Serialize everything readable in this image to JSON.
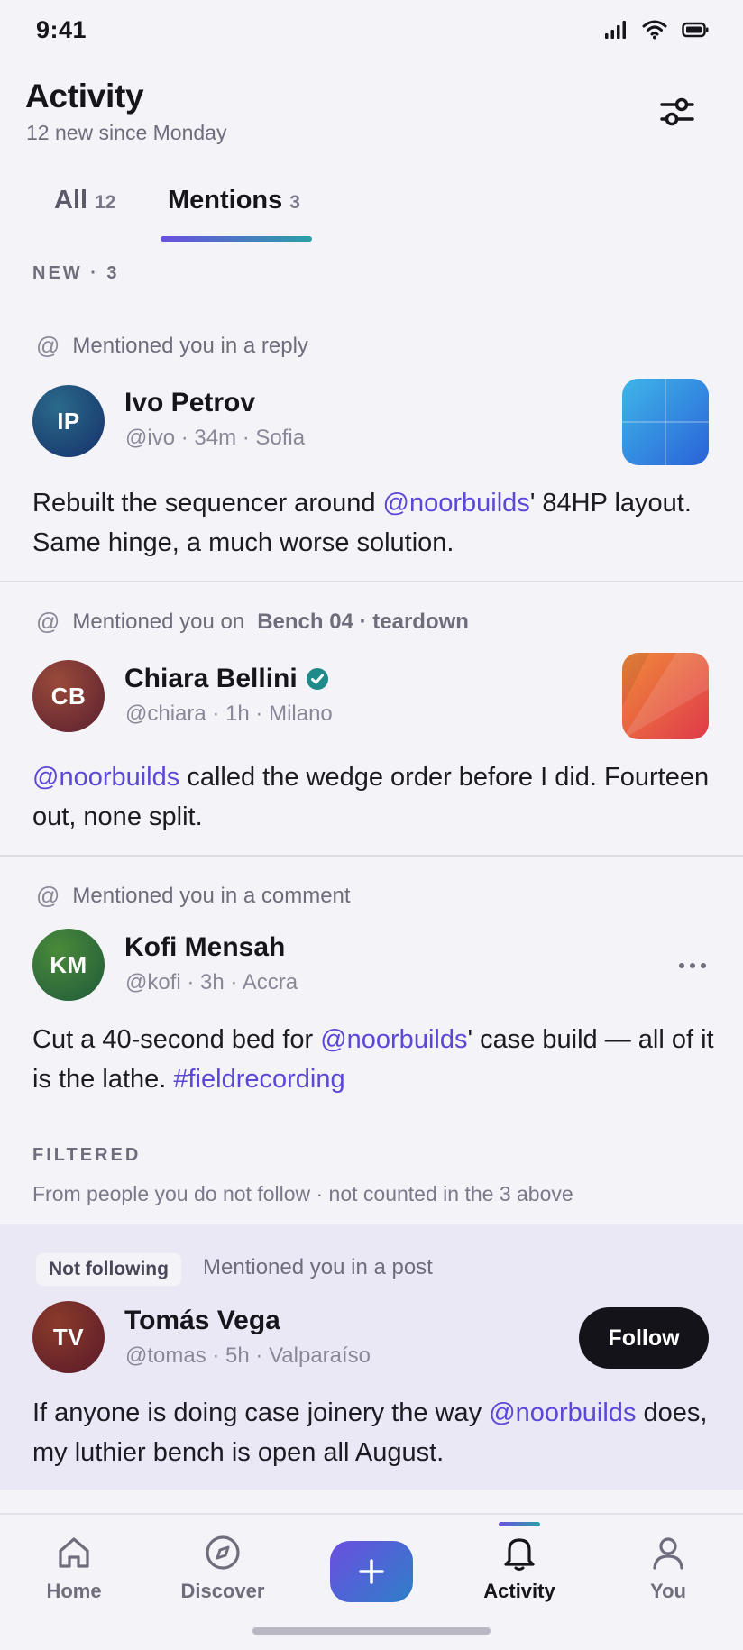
{
  "status_bar": {
    "time": "9:41"
  },
  "header": {
    "title": "Activity",
    "subtitle": "12 new since Monday"
  },
  "tabs": [
    {
      "label": "All",
      "count": "12",
      "active": false
    },
    {
      "label": "Mentions",
      "count": "3",
      "active": true
    }
  ],
  "sections": {
    "new_label": "NEW · 3",
    "filtered_label": "FILTERED",
    "filtered_note": "From people you do not follow · not counted in the 3 above"
  },
  "mentions": [
    {
      "reason": "Mentioned you in a reply",
      "reason_target": "",
      "initials": "IP",
      "name": "Ivo Petrov",
      "verified": false,
      "meta": "@ivo · 34m · Sofia",
      "text_parts": [
        {
          "t": "Rebuilt the sequencer around ",
          "m": false
        },
        {
          "t": "@noorbuilds",
          "m": true
        },
        {
          "t": "' 84HP layout. Same hinge, a much worse solution.",
          "m": false
        }
      ],
      "avatar_color": "#1d4c8a",
      "thumb": "blue-grid"
    },
    {
      "reason": "Mentioned you on",
      "reason_target": "Bench 04 · teardown",
      "initials": "CB",
      "name": "Chiara Bellini",
      "verified": true,
      "meta": "@chiara · 1h · Milano",
      "text_parts": [
        {
          "t": "@noorbuilds",
          "m": true
        },
        {
          "t": " called the wedge order before I did. Fourteen out, none split.",
          "m": false
        }
      ],
      "avatar_color": "#7a2f2f",
      "thumb": "orange-red"
    },
    {
      "reason": "Mentioned you in a comment",
      "reason_target": "",
      "initials": "KM",
      "name": "Kofi Mensah",
      "verified": false,
      "meta": "@kofi · 3h · Accra",
      "text_parts": [
        {
          "t": "Cut a 40-second bed for ",
          "m": false
        },
        {
          "t": "@noorbuilds",
          "m": true
        },
        {
          "t": "' case build — all of it is the lathe. ",
          "m": false
        },
        {
          "t": "#fieldrecording",
          "m": true
        }
      ],
      "avatar_color": "#2f6b3a",
      "thumb": ""
    }
  ],
  "filtered_post": {
    "badge": "Not following",
    "reason": "Mentioned you in a post",
    "initials": "TV",
    "name": "Tomás Vega",
    "meta": "@tomas · 5h · Valparaíso",
    "follow_label": "Follow",
    "text_parts": [
      {
        "t": "If anyone is doing case joinery the way ",
        "m": false
      },
      {
        "t": "@noorbuilds",
        "m": true
      },
      {
        "t": " does, my luthier bench is open all August.",
        "m": false
      }
    ]
  },
  "bottom_nav": [
    {
      "label": "Home",
      "icon": "home-icon"
    },
    {
      "label": "Discover",
      "icon": "compass-icon"
    },
    {
      "label": "Activity",
      "icon": "bell-icon",
      "active": true
    },
    {
      "label": "You",
      "icon": "person-icon"
    }
  ],
  "colors": {
    "accent": "#5b48d6",
    "teal": "#2aa0a6",
    "follow_bg": "#14131a"
  }
}
